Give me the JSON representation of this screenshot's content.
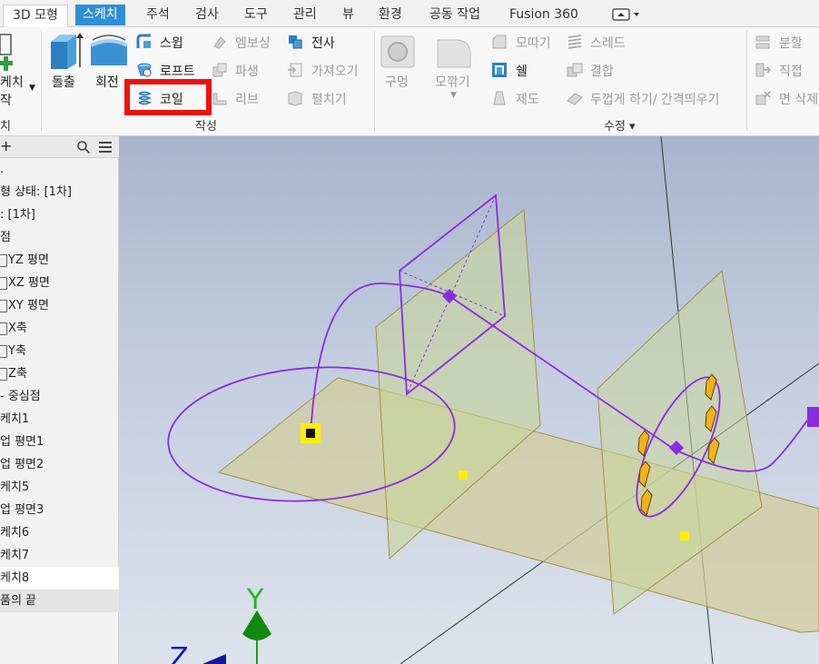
{
  "tabs": [
    "3D 모형",
    "스케치",
    "주석",
    "검사",
    "도구",
    "관리",
    "뷰",
    "환경",
    "공동 작업",
    "Fusion 360"
  ],
  "ribbon": {
    "left_partial": {
      "label_line1": "케치",
      "label_line2": "작",
      "group": "치"
    },
    "create": {
      "extrude": "돌출",
      "revolve": "회전",
      "sweep": "스윕",
      "loft": "로프트",
      "coil": "코일",
      "emboss": "엠보싱",
      "derive": "파생",
      "rib": "리브",
      "decal": "전사",
      "import": "가져오기",
      "unwrap": "펼치기",
      "group": "작성"
    },
    "modify": {
      "hole": "구멍",
      "fillet": "모깎기",
      "chamfer": "모따기",
      "shell": "쉘",
      "draft": "제도",
      "thread": "스레드",
      "combine": "결합",
      "thicken": "두껍게 하기/ 간격띄우기",
      "split": "분할",
      "direct": "직접",
      "delete_face": "면 삭제",
      "group": "수정 ▾"
    }
  },
  "browser": {
    "header_plus": "+",
    "items": [
      ".",
      "형 상태: [1차]",
      ": [1차]",
      "점",
      "YZ 평면",
      "XZ 평면",
      "XY 평면",
      "X축",
      "Y축",
      "Z축",
      "- 중심점",
      "케치1",
      "업 평면1",
      "업 평면2",
      "케치5",
      "업 평면3",
      "케치6",
      "케치7",
      "케치8",
      "품의 끝"
    ]
  },
  "triad": {
    "y": "Y",
    "z": "Z"
  },
  "colors": {
    "active_tab": "#2f8fd6",
    "highlight": "#ee1111",
    "sketch_curve": "#8a2be2",
    "plane_fill": "#c8d59a",
    "sketch_point": "#ffee00"
  }
}
